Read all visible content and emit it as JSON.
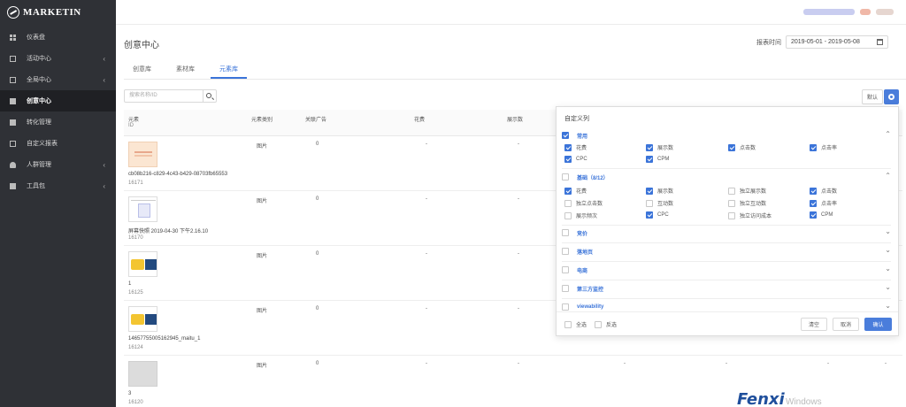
{
  "app": {
    "logo": "MARKETIN"
  },
  "sidebar": {
    "items": [
      {
        "label": "仪表盘",
        "icon": "dashboard-icon",
        "chevron": false,
        "active": false
      },
      {
        "label": "活动中心",
        "icon": "activity-icon",
        "chevron": true,
        "active": false
      },
      {
        "label": "全局中心",
        "icon": "global-icon",
        "chevron": true,
        "active": false
      },
      {
        "label": "创意中心",
        "icon": "creative-icon",
        "chevron": false,
        "active": true
      },
      {
        "label": "转化管理",
        "icon": "conversion-icon",
        "chevron": false,
        "active": false
      },
      {
        "label": "自定义报表",
        "icon": "report-icon",
        "chevron": false,
        "active": false
      },
      {
        "label": "人群管理",
        "icon": "audience-icon",
        "chevron": true,
        "active": false
      },
      {
        "label": "工具包",
        "icon": "toolkit-icon",
        "chevron": true,
        "active": false
      }
    ]
  },
  "page": {
    "title": "创意中心"
  },
  "date": {
    "label": "报表时间",
    "value": "2019-05-01 - 2019-05-08"
  },
  "tabs": [
    {
      "label": "创意库",
      "active": false
    },
    {
      "label": "素材库",
      "active": false
    },
    {
      "label": "元素库",
      "active": true
    }
  ],
  "search": {
    "placeholder": "搜索名称/ID"
  },
  "toolbar": {
    "default_label": "默认"
  },
  "table": {
    "headers": {
      "element": "元素",
      "id": "ID",
      "type": "元素类别",
      "ads": "关联广告",
      "cost": "花费",
      "impressions": "展示数"
    },
    "rows": [
      {
        "name": "cb08b216-c829-4c43-b429-08703fb65553",
        "id": "16171",
        "type": "图片",
        "ads": "0",
        "cost": "-",
        "impressions": "-",
        "thumb": "thumb1"
      },
      {
        "name": "屏幕快照 2019-04-30 下午2.16.10",
        "id": "16170",
        "type": "图片",
        "ads": "0",
        "cost": "-",
        "impressions": "-",
        "thumb": "thumb2"
      },
      {
        "name": "1",
        "id": "16125",
        "type": "图片",
        "ads": "0",
        "cost": "-",
        "impressions": "-",
        "thumb": "thumb3"
      },
      {
        "name": "1465775500516294​5_maitu_1",
        "id": "16124",
        "type": "图片",
        "ads": "0",
        "cost": "-",
        "impressions": "-",
        "thumb": "thumb3"
      },
      {
        "name": "3",
        "id": "16120",
        "type": "图片",
        "ads": "0",
        "cost": "-",
        "impressions": "-",
        "thumb": "thumb5"
      }
    ],
    "row5_extra": [
      "-",
      "-",
      "-",
      "-",
      "-"
    ]
  },
  "popover": {
    "title": "自定义列",
    "groups": [
      {
        "label": "常用",
        "checked": true,
        "expanded": true,
        "options": [
          {
            "label": "花费",
            "checked": true
          },
          {
            "label": "展示数",
            "checked": true
          },
          {
            "label": "点击数",
            "checked": true
          },
          {
            "label": "点击率",
            "checked": true
          },
          {
            "label": "CPC",
            "checked": true
          },
          {
            "label": "CPM",
            "checked": true
          }
        ]
      },
      {
        "label": "基础（8/12）",
        "checked": false,
        "expanded": true,
        "options": [
          {
            "label": "花费",
            "checked": true
          },
          {
            "label": "展示数",
            "checked": true
          },
          {
            "label": "独立展示数",
            "checked": false
          },
          {
            "label": "点击数",
            "checked": true
          },
          {
            "label": "独立点击数",
            "checked": false
          },
          {
            "label": "互动数",
            "checked": false
          },
          {
            "label": "独立互动数",
            "checked": false
          },
          {
            "label": "点击率",
            "checked": true
          },
          {
            "label": "展示频次",
            "checked": false
          },
          {
            "label": "CPC",
            "checked": true
          },
          {
            "label": "独立访问成本",
            "checked": false
          },
          {
            "label": "CPM",
            "checked": true
          }
        ]
      },
      {
        "label": "竞价",
        "checked": false,
        "expanded": false
      },
      {
        "label": "落地页",
        "checked": false,
        "expanded": false
      },
      {
        "label": "电商",
        "checked": false,
        "expanded": false
      },
      {
        "label": "第三方监控",
        "checked": false,
        "expanded": false
      },
      {
        "label": "viewability",
        "checked": false,
        "expanded": false
      }
    ],
    "footer": {
      "select_all": "全选",
      "invert": "反选",
      "clear": "清空",
      "cancel": "取消",
      "confirm": "确认"
    }
  },
  "watermark": {
    "brand": "Fenxi",
    "os": "Windows"
  }
}
